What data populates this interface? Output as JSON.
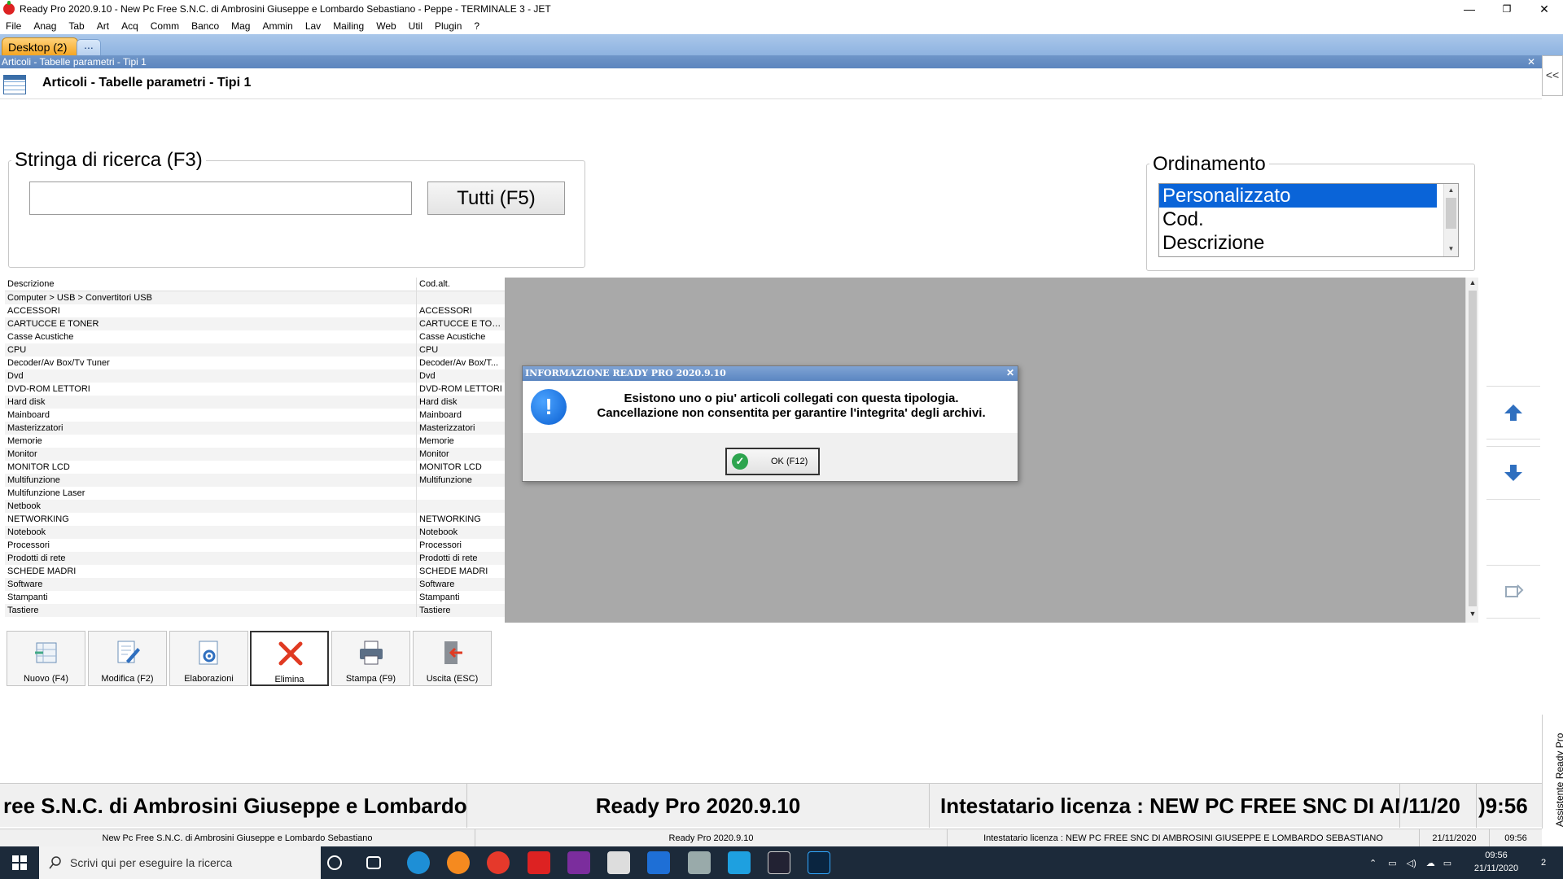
{
  "window": {
    "title": "Ready Pro 2020.9.10 - New Pc Free S.N.C. di Ambrosini Giuseppe e Lombardo Sebastiano - Peppe - TERMINALE 3 - JET",
    "minimize": "—",
    "restore": "❐",
    "close": "✕"
  },
  "menu": [
    "File",
    "Anag",
    "Tab",
    "Art",
    "Acq",
    "Comm",
    "Banco",
    "Mag",
    "Ammin",
    "Lav",
    "Mailing",
    "Web",
    "Util",
    "Plugin",
    "?"
  ],
  "tabs": {
    "desktop": "Desktop (2)",
    "more": "..."
  },
  "subwindow": {
    "bar_title": "Articoli - Tabelle parametri - Tipi 1",
    "close": "✕",
    "header_title": "Articoli - Tabelle parametri - Tipi 1",
    "collapse": "<<"
  },
  "search": {
    "legend": "Stringa di ricerca (F3)",
    "value": "",
    "all_button": "Tutti (F5)"
  },
  "ordering": {
    "legend": "Ordinamento",
    "options": [
      "Personalizzato",
      "Cod.",
      "Descrizione"
    ],
    "selected": "Personalizzato"
  },
  "table": {
    "columns": [
      "Descrizione",
      "Cod.alt."
    ],
    "rows": [
      [
        "Computer > USB > Convertitori USB",
        ""
      ],
      [
        "ACCESSORI",
        "ACCESSORI"
      ],
      [
        "CARTUCCE E TONER",
        "CARTUCCE E TONER"
      ],
      [
        "Casse Acustiche",
        "Casse Acustiche"
      ],
      [
        "CPU",
        "CPU"
      ],
      [
        "Decoder/Av Box/Tv Tuner",
        "Decoder/Av Box/T..."
      ],
      [
        "Dvd",
        "Dvd"
      ],
      [
        "DVD-ROM LETTORI",
        "DVD-ROM LETTORI"
      ],
      [
        "Hard disk",
        "Hard disk"
      ],
      [
        "Mainboard",
        "Mainboard"
      ],
      [
        "Masterizzatori",
        "Masterizzatori"
      ],
      [
        "Memorie",
        "Memorie"
      ],
      [
        "Monitor",
        "Monitor"
      ],
      [
        "MONITOR LCD",
        "MONITOR LCD"
      ],
      [
        "Multifunzione",
        "Multifunzione"
      ],
      [
        "Multifunzione Laser",
        ""
      ],
      [
        "Netbook",
        ""
      ],
      [
        "NETWORKING",
        "NETWORKING"
      ],
      [
        "Notebook",
        "Notebook"
      ],
      [
        "Processori",
        "Processori"
      ],
      [
        "Prodotti di rete",
        "Prodotti di rete"
      ],
      [
        "SCHEDE MADRI",
        "SCHEDE MADRI"
      ],
      [
        "Software",
        "Software"
      ],
      [
        "Stampanti",
        "Stampanti"
      ],
      [
        "Tastiere",
        "Tastiere"
      ]
    ]
  },
  "dialog": {
    "title": "INFORMAZIONE READY PRO 2020.9.10",
    "close": "✕",
    "icon": "!",
    "line1": "Esistono uno o piu' articoli collegati con questa tipologia.",
    "line2": "Cancellazione non consentita per garantire l'integrita' degli archivi.",
    "ok_label": "OK (F12)",
    "ok_icon": "✓"
  },
  "toolbar": {
    "nuovo": "Nuovo (F4)",
    "modifica": "Modifica (F2)",
    "elaborazioni": "Elaborazioni",
    "elimina": "Elimina",
    "stampa": "Stampa (F9)",
    "uscita": "Uscita (ESC)"
  },
  "status_big": {
    "company": "ree S.N.C. di Ambrosini Giuseppe e Lombardo Se",
    "version": "Ready Pro 2020.9.10",
    "license": "Intestatario licenza : NEW PC FREE SNC DI AM",
    "date": "/11/20",
    "time": ")9:56"
  },
  "status_small": {
    "company": "New Pc Free S.N.C. di Ambrosini Giuseppe e Lombardo Sebastiano",
    "version": "Ready Pro 2020.9.10",
    "license": "Intestatario licenza : NEW PC FREE SNC DI AMBROSINI GIUSEPPE E LOMBARDO SEBASTIANO",
    "date": "21/11/2020",
    "time": "09:56"
  },
  "assistant": "Assistente Ready Pro",
  "taskbar": {
    "search_placeholder": "Scrivi qui per eseguire la ricerca",
    "clock_time": "09:56",
    "clock_date": "21/11/2020",
    "notifications": "2"
  },
  "colors": {
    "selection": "#0a64d8",
    "titlebar_blue": "#5b86c1",
    "desktop_tab": "#f5a623",
    "table_bg": "#a9a9a9",
    "taskbar": "#1c2a3a"
  }
}
